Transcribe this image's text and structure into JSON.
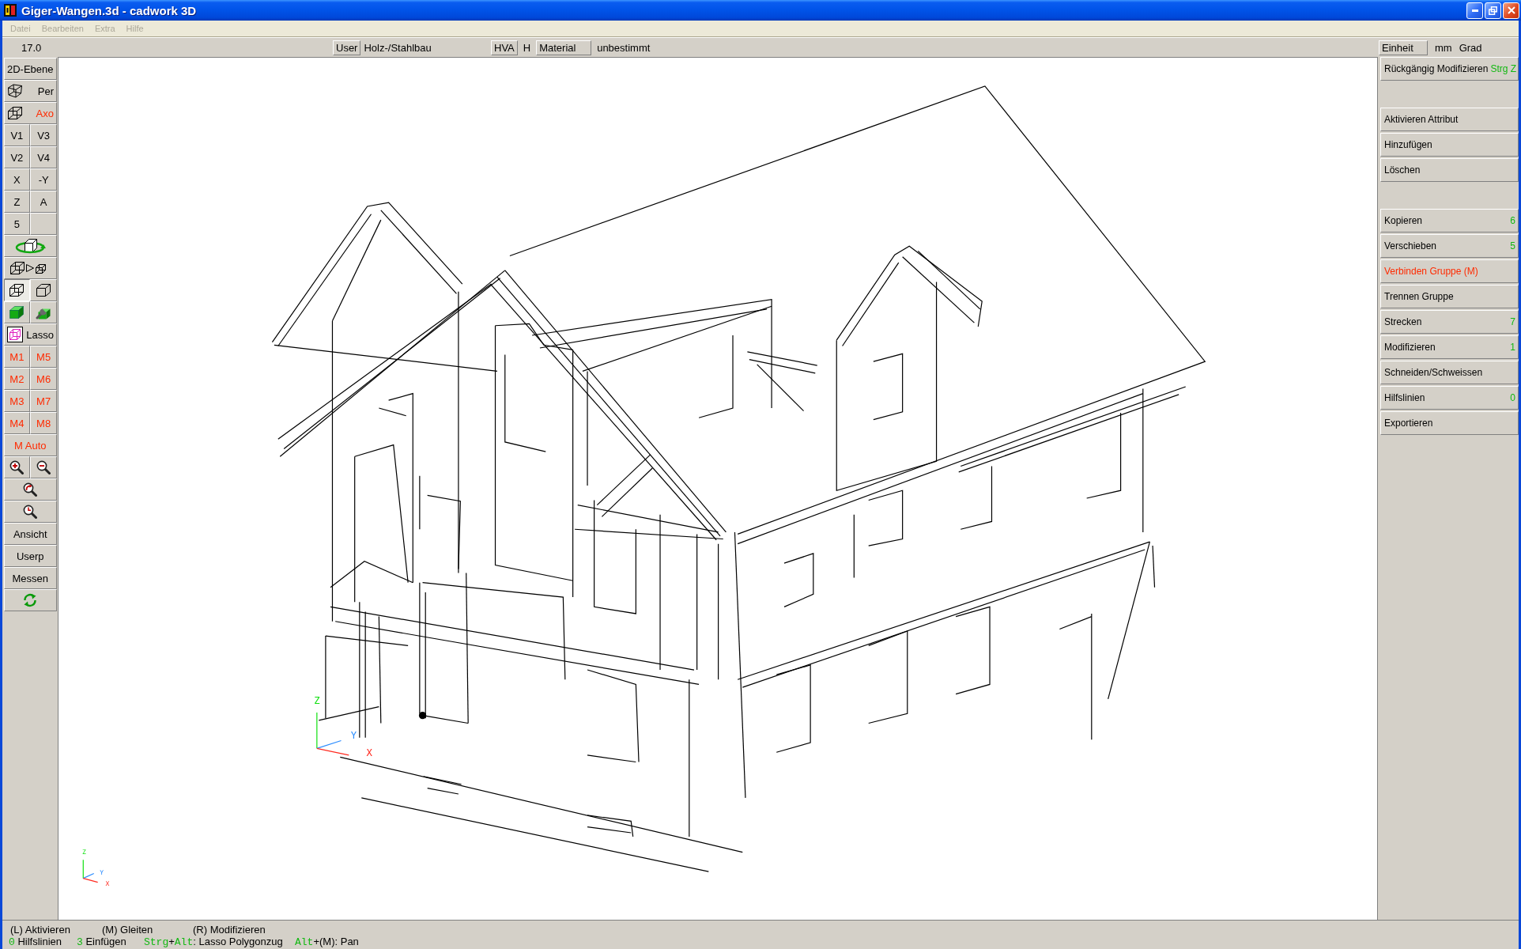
{
  "window": {
    "title": "Giger-Wangen.3d - cadwork 3D"
  },
  "menu": [
    {
      "label": "Datei",
      "disabled": true
    },
    {
      "label": "Bearbeiten",
      "disabled": true
    },
    {
      "label": "Extra",
      "disabled": true
    },
    {
      "label": "Hilfe",
      "disabled": true
    }
  ],
  "toolbar": {
    "version": "17.0",
    "groups": [
      [
        {
          "kind": "button",
          "label": "User"
        },
        {
          "kind": "text",
          "label": "Holz-/Stahlbau"
        }
      ],
      [
        {
          "kind": "button",
          "label": "HVA"
        },
        {
          "kind": "text",
          "label": "H"
        },
        {
          "kind": "button",
          "label": "Material"
        },
        {
          "kind": "text",
          "label": "unbestimmt"
        }
      ],
      [
        {
          "kind": "button",
          "label": "Einheit"
        },
        {
          "kind": "text",
          "label": "mm"
        },
        {
          "kind": "text",
          "label": "Grad"
        }
      ]
    ]
  },
  "left_toolbar": [
    [
      {
        "kind": "text",
        "label": "2D-Ebene",
        "highlighted": false,
        "pressed": false
      }
    ],
    [
      {
        "kind": "icon_text",
        "label": "Per",
        "highlighted": false,
        "pressed": false
      }
    ],
    [
      {
        "kind": "icon_text",
        "label": "Axo",
        "highlighted": true,
        "pressed": false
      }
    ],
    [
      {
        "kind": "text",
        "label": "V1",
        "highlighted": false,
        "pressed": false
      },
      {
        "kind": "text",
        "label": "V3",
        "highlighted": false,
        "pressed": false
      }
    ],
    [
      {
        "kind": "text",
        "label": "V2",
        "highlighted": false,
        "pressed": false
      },
      {
        "kind": "text",
        "label": "V4",
        "highlighted": false,
        "pressed": false
      }
    ],
    [
      {
        "kind": "text",
        "label": "X",
        "highlighted": false,
        "pressed": false
      },
      {
        "kind": "text",
        "label": "-Y",
        "highlighted": false,
        "pressed": false
      }
    ],
    [
      {
        "kind": "text",
        "label": "Z",
        "highlighted": false,
        "pressed": false
      },
      {
        "kind": "text",
        "label": "A",
        "highlighted": false,
        "pressed": false
      }
    ],
    [
      {
        "kind": "text",
        "label": "5",
        "highlighted": false,
        "pressed": false
      },
      {
        "kind": "blank",
        "pressed": false
      }
    ],
    [
      {
        "kind": "icon",
        "pressed": false
      }
    ],
    [
      {
        "kind": "icon",
        "pressed": false
      }
    ],
    [
      {
        "kind": "icon",
        "pressed": true
      },
      {
        "kind": "icon",
        "pressed": false
      }
    ],
    [
      {
        "kind": "icon",
        "pressed": false
      },
      {
        "kind": "icon",
        "pressed": false
      }
    ],
    [
      {
        "kind": "icon_text",
        "label": "Lasso",
        "highlighted": false,
        "pressed": false
      }
    ],
    [
      {
        "kind": "text",
        "label": "M1",
        "highlighted": true,
        "pressed": false
      },
      {
        "kind": "text",
        "label": "M5",
        "highlighted": true,
        "pressed": false
      }
    ],
    [
      {
        "kind": "text",
        "label": "M2",
        "highlighted": true,
        "pressed": false
      },
      {
        "kind": "text",
        "label": "M6",
        "highlighted": true,
        "pressed": false
      }
    ],
    [
      {
        "kind": "text",
        "label": "M3",
        "highlighted": true,
        "pressed": false
      },
      {
        "kind": "text",
        "label": "M7",
        "highlighted": true,
        "pressed": false
      }
    ],
    [
      {
        "kind": "text",
        "label": "M4",
        "highlighted": true,
        "pressed": false
      },
      {
        "kind": "text",
        "label": "M8",
        "highlighted": true,
        "pressed": false
      }
    ],
    [
      {
        "kind": "text",
        "label": "M Auto",
        "highlighted": true,
        "pressed": false
      }
    ],
    [
      {
        "kind": "icon",
        "pressed": false
      },
      {
        "kind": "icon",
        "pressed": false
      }
    ],
    [
      {
        "kind": "icon",
        "pressed": false
      }
    ],
    [
      {
        "kind": "icon",
        "pressed": false
      }
    ],
    [
      {
        "kind": "text",
        "label": "Ansicht",
        "highlighted": false,
        "pressed": false
      }
    ],
    [
      {
        "kind": "text",
        "label": "Userp",
        "highlighted": false,
        "pressed": false
      }
    ],
    [
      {
        "kind": "text",
        "label": "Messen",
        "highlighted": false,
        "pressed": false
      }
    ],
    [
      {
        "kind": "icon",
        "pressed": false
      }
    ]
  ],
  "viewport": {
    "origin_axes": {
      "x": "X",
      "y": "Y",
      "z": "Z"
    },
    "corner_axes": {
      "x": "X",
      "y": "Y",
      "z": "Z"
    }
  },
  "right_panel": [
    [
      {
        "label": "Rückgängig Modifizieren",
        "shortcut": "Strg Z",
        "highlighted": false
      }
    ],
    [
      {
        "label": "Aktivieren Attribut",
        "highlighted": false
      },
      {
        "label": "Hinzufügen",
        "highlighted": false
      },
      {
        "label": "Löschen",
        "highlighted": false
      }
    ],
    [
      {
        "label": "Kopieren",
        "shortcut": "6",
        "highlighted": false
      },
      {
        "label": "Verschieben",
        "shortcut": "5",
        "highlighted": false
      },
      {
        "label": "Verbinden Gruppe (M)",
        "highlighted": true
      },
      {
        "label": "Trennen Gruppe",
        "highlighted": false
      },
      {
        "label": "Strecken",
        "shortcut": "7",
        "highlighted": false
      },
      {
        "label": "Modifizieren",
        "shortcut": "1",
        "highlighted": false
      },
      {
        "label": "Schneiden/Schweissen",
        "highlighted": false
      },
      {
        "label": "Hilfslinien",
        "shortcut": "0",
        "highlighted": false
      },
      {
        "label": "Exportieren",
        "highlighted": false
      }
    ]
  ],
  "status_bar": {
    "line_1": [
      "(L) Aktivieren",
      "(M) Gleiten",
      "(R) Modifizieren"
    ],
    "line_2": [
      [
        {
          "kind": "key",
          "text": "0"
        },
        {
          "kind": "text",
          "text": " Hilfslinien"
        }
      ],
      [
        {
          "kind": "key",
          "text": "3"
        },
        {
          "kind": "text",
          "text": " Einfügen"
        }
      ],
      [
        {
          "kind": "key",
          "text": "Strg"
        },
        {
          "kind": "text",
          "text": "+"
        },
        {
          "kind": "key",
          "text": "Alt"
        },
        {
          "kind": "text",
          "text": ": Lasso Polygonzug"
        }
      ],
      [
        {
          "kind": "key",
          "text": "Alt"
        },
        {
          "kind": "text",
          "text": "+(M): Pan"
        }
      ]
    ]
  }
}
